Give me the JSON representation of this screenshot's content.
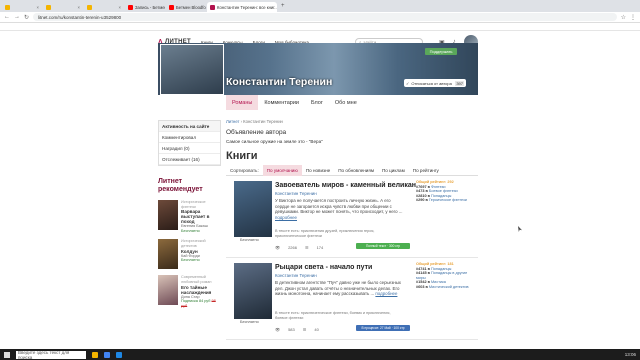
{
  "browser": {
    "tabs": [
      {
        "label": "",
        "color": "#f4b400"
      },
      {
        "label": "",
        "color": "#f4b400"
      },
      {
        "label": "",
        "color": "#f4b400"
      },
      {
        "label": "Запись - Бетмен Bloodfor...",
        "color": "#ff0000"
      },
      {
        "label": "Бетмен Bloodfor - YouTube",
        "color": "#ff0000"
      },
      {
        "label": "Константин Теренин: все книг...",
        "color": "#b3134e",
        "active": true
      }
    ],
    "url": "litnet.com/ru/konstantin-terenin-u3529800"
  },
  "header": {
    "logo": "ЛИТНЕТ",
    "menu": [
      "Книги",
      "Конкурсы",
      "Блоги",
      "Моя библиотека"
    ],
    "search_placeholder": "Найти"
  },
  "banner": {
    "author_name": "Константин Теренин",
    "subscribe_label": "Отписаться от автора",
    "subscribe_count": "397",
    "support_label": "Поддержать"
  },
  "profile_tabs": [
    "Романы",
    "Комментарии",
    "Блог",
    "Обо мне"
  ],
  "sidebar": {
    "items": [
      {
        "label": "Активность на сайте"
      },
      {
        "label": "Комментировал"
      },
      {
        "label": "Наградил (0)"
      },
      {
        "label": "Отслеживает (16)"
      }
    ],
    "rec_title": "Литнет рекомендует",
    "recommended": [
      {
        "category": "Историческое фэнтези",
        "title": "Варвара выступает в поход",
        "author": "Евгения Бакаш",
        "price": "Бесплатно",
        "old": ""
      },
      {
        "category": "Исторический детектив",
        "title": "Колдун",
        "author": "Кай Форди",
        "price": "Бесплатно",
        "old": ""
      },
      {
        "category": "Современный любовный роман",
        "title": "Его тайные наслаждения",
        "author": "Дина Стар",
        "price": "Подписка 84 руб",
        "old": "98 руб"
      }
    ]
  },
  "main": {
    "breadcrumb_root": "Литнет",
    "breadcrumb_current": "Константин Теренин",
    "announcement_title": "Объявление автора",
    "announcement_text": "Самое сильное оружие на земле это - \"Вера\"",
    "books_heading": "Книги",
    "sort_label": "Сортировать:",
    "sort_options": [
      "По умолчанию",
      "По новизне",
      "По обновлениям",
      "По циклам",
      "По рейтингу"
    ]
  },
  "books": [
    {
      "title": "Завоеватель миров - каменный великан",
      "author": "Константин Теренин",
      "desc": "У Виктора не получается построить личную жизнь. А его сердце не загорается искра чувств любви при общении с девушками. Виктор не может понять, что происходит, у него ...",
      "more": "подробнее",
      "price": "Бесплатно",
      "tags": "В тексте есть: приключения друзей, приключения героя, приключенческое фэнтези",
      "views": "2266",
      "comments": "174",
      "status": "Полный текст · 300 стр",
      "rating_label": "Общий рейтинг: 292",
      "ranks": [
        {
          "place": "#7697 в",
          "genre": "Фэнтези"
        },
        {
          "place": "#473 в",
          "genre": "Боевое фэнтези"
        },
        {
          "place": "#2810 в",
          "genre": "Попаданцы"
        },
        {
          "place": "#290 в",
          "genre": "Героическое фэнтези"
        }
      ]
    },
    {
      "title": "Рыцари света - начало пути",
      "author": "Константин Теренин",
      "desc": "В детективном агентстве \"Пуч\" давно уже не было серьезных дел. Джон устал давать отчёты о незначительных делах. Его жизнь монотонна, начинает ему рассказывать ...",
      "more": "подробнее",
      "price": "Бесплатно",
      "tags": "В тексте есть: приключенческое фэнтези, боевик и приключения, боевое фэнтези",
      "views": "583",
      "comments": "40",
      "status": "В процессе: 27 Май · 100 стр",
      "rating_label": "Общий рейтинг: 181",
      "ranks": [
        {
          "place": "#4741 в",
          "genre": "Попаданцы"
        },
        {
          "place": "#4145 в",
          "genre": "Попаданцы в другие миры"
        },
        {
          "place": "#1542 в",
          "genre": "Мистика"
        },
        {
          "place": "#603 в",
          "genre": "Мистический детектив"
        }
      ]
    }
  ],
  "taskbar": {
    "search": "Введите здесь текст для поиска",
    "time": "13:06"
  },
  "colors": {
    "accent": "#b3134e",
    "link": "#3b6ea5",
    "green": "#4caf50"
  }
}
